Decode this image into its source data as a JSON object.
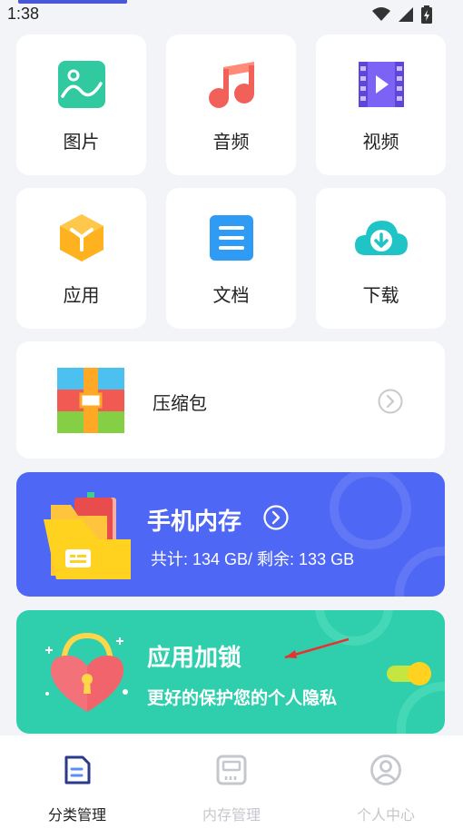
{
  "status_bar": {
    "time": "1:38"
  },
  "categories": [
    {
      "label": "图片",
      "icon": "image-icon"
    },
    {
      "label": "音频",
      "icon": "music-icon"
    },
    {
      "label": "视频",
      "icon": "video-icon"
    },
    {
      "label": "应用",
      "icon": "app-icon"
    },
    {
      "label": "文档",
      "icon": "document-icon"
    },
    {
      "label": "下载",
      "icon": "download-icon"
    }
  ],
  "zip": {
    "label": "压缩包"
  },
  "storage": {
    "title": "手机内存",
    "summary": "共计: 134 GB/ 剩余: 133 GB"
  },
  "app_lock": {
    "title": "应用加锁",
    "subtitle": "更好的保护您的个人隐私",
    "toggle_on": true
  },
  "bottom_nav": {
    "items": [
      {
        "label": "分类管理",
        "active": true
      },
      {
        "label": "内存管理",
        "active": false
      },
      {
        "label": "个人中心",
        "active": false
      }
    ]
  },
  "colors": {
    "storage_card": "#4f67f5",
    "lock_card": "#2fcfad",
    "active_nav": "#222222",
    "inactive_nav": "#c5c7cc"
  }
}
